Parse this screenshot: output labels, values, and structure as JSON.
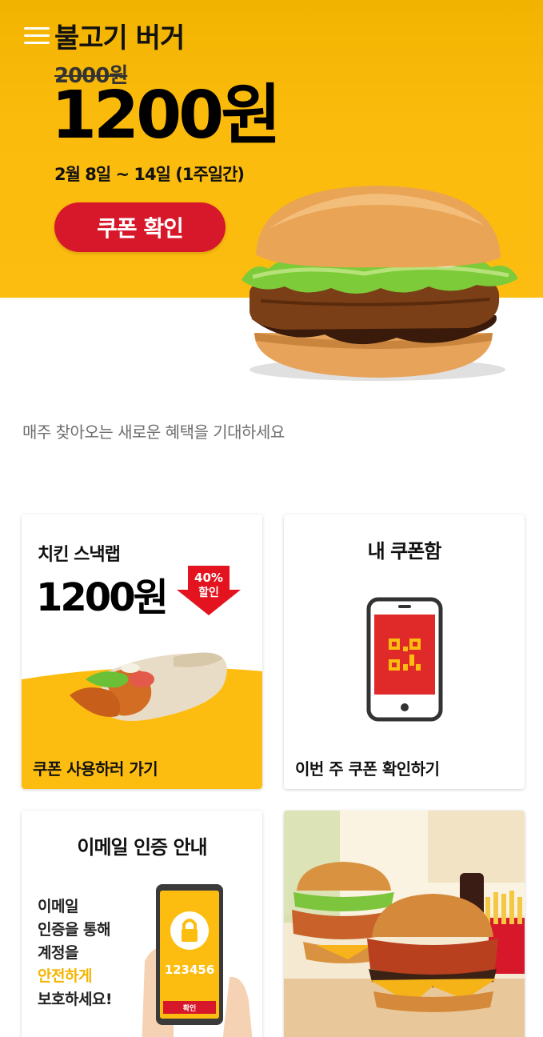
{
  "hero": {
    "title": "불고기 버거",
    "old_price": "2000원",
    "new_price": "1200원",
    "period": "2월 8일 ~ 14일 (1주일간)",
    "coupon_button": "쿠폰 확인"
  },
  "subtitle": "매주 찾아오는 새로운 혜택을 기대하세요",
  "cards": {
    "snack_wrap": {
      "title": "치킨 스낵랩",
      "price": "1200원",
      "badge_percent": "40%",
      "badge_label": "할인",
      "cta": "쿠폰 사용하러 가기"
    },
    "my_coupons": {
      "title": "내 쿠폰함",
      "cta": "이번 주 쿠폰 확인하기"
    },
    "email_verify": {
      "title": "이메일 인증 안내",
      "line1": "이메일",
      "line2": "인증을 통해",
      "line3": "계정을",
      "line4_highlight": "안전하게",
      "line5": "보호하세요!",
      "phone_code": "123456",
      "phone_button": "확인"
    }
  },
  "colors": {
    "brand_yellow": "#fdbd10",
    "brand_red": "#d7182a"
  }
}
